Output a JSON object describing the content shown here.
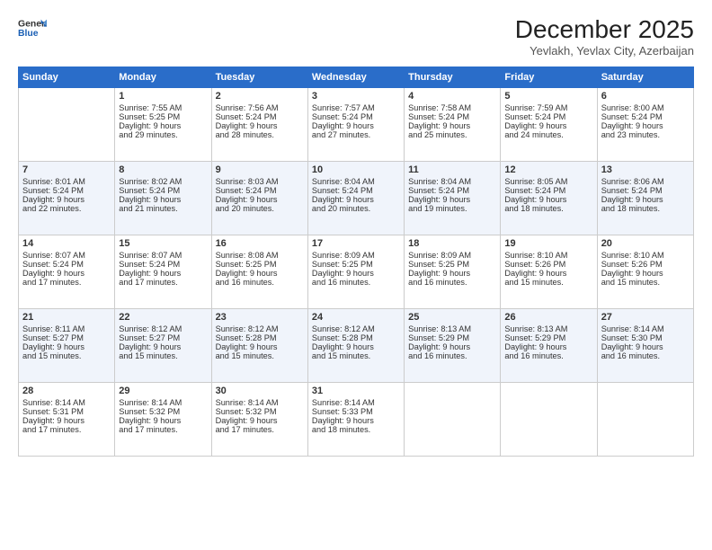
{
  "header": {
    "logo_line1": "General",
    "logo_line2": "Blue",
    "month": "December 2025",
    "location": "Yevlakh, Yevlax City, Azerbaijan"
  },
  "days_of_week": [
    "Sunday",
    "Monday",
    "Tuesday",
    "Wednesday",
    "Thursday",
    "Friday",
    "Saturday"
  ],
  "weeks": [
    [
      {
        "day": "",
        "info": ""
      },
      {
        "day": "1",
        "info": "Sunrise: 7:55 AM\nSunset: 5:25 PM\nDaylight: 9 hours\nand 29 minutes."
      },
      {
        "day": "2",
        "info": "Sunrise: 7:56 AM\nSunset: 5:24 PM\nDaylight: 9 hours\nand 28 minutes."
      },
      {
        "day": "3",
        "info": "Sunrise: 7:57 AM\nSunset: 5:24 PM\nDaylight: 9 hours\nand 27 minutes."
      },
      {
        "day": "4",
        "info": "Sunrise: 7:58 AM\nSunset: 5:24 PM\nDaylight: 9 hours\nand 25 minutes."
      },
      {
        "day": "5",
        "info": "Sunrise: 7:59 AM\nSunset: 5:24 PM\nDaylight: 9 hours\nand 24 minutes."
      },
      {
        "day": "6",
        "info": "Sunrise: 8:00 AM\nSunset: 5:24 PM\nDaylight: 9 hours\nand 23 minutes."
      }
    ],
    [
      {
        "day": "7",
        "info": "Sunrise: 8:01 AM\nSunset: 5:24 PM\nDaylight: 9 hours\nand 22 minutes."
      },
      {
        "day": "8",
        "info": "Sunrise: 8:02 AM\nSunset: 5:24 PM\nDaylight: 9 hours\nand 21 minutes."
      },
      {
        "day": "9",
        "info": "Sunrise: 8:03 AM\nSunset: 5:24 PM\nDaylight: 9 hours\nand 20 minutes."
      },
      {
        "day": "10",
        "info": "Sunrise: 8:04 AM\nSunset: 5:24 PM\nDaylight: 9 hours\nand 20 minutes."
      },
      {
        "day": "11",
        "info": "Sunrise: 8:04 AM\nSunset: 5:24 PM\nDaylight: 9 hours\nand 19 minutes."
      },
      {
        "day": "12",
        "info": "Sunrise: 8:05 AM\nSunset: 5:24 PM\nDaylight: 9 hours\nand 18 minutes."
      },
      {
        "day": "13",
        "info": "Sunrise: 8:06 AM\nSunset: 5:24 PM\nDaylight: 9 hours\nand 18 minutes."
      }
    ],
    [
      {
        "day": "14",
        "info": "Sunrise: 8:07 AM\nSunset: 5:24 PM\nDaylight: 9 hours\nand 17 minutes."
      },
      {
        "day": "15",
        "info": "Sunrise: 8:07 AM\nSunset: 5:24 PM\nDaylight: 9 hours\nand 17 minutes."
      },
      {
        "day": "16",
        "info": "Sunrise: 8:08 AM\nSunset: 5:25 PM\nDaylight: 9 hours\nand 16 minutes."
      },
      {
        "day": "17",
        "info": "Sunrise: 8:09 AM\nSunset: 5:25 PM\nDaylight: 9 hours\nand 16 minutes."
      },
      {
        "day": "18",
        "info": "Sunrise: 8:09 AM\nSunset: 5:25 PM\nDaylight: 9 hours\nand 16 minutes."
      },
      {
        "day": "19",
        "info": "Sunrise: 8:10 AM\nSunset: 5:26 PM\nDaylight: 9 hours\nand 15 minutes."
      },
      {
        "day": "20",
        "info": "Sunrise: 8:10 AM\nSunset: 5:26 PM\nDaylight: 9 hours\nand 15 minutes."
      }
    ],
    [
      {
        "day": "21",
        "info": "Sunrise: 8:11 AM\nSunset: 5:27 PM\nDaylight: 9 hours\nand 15 minutes."
      },
      {
        "day": "22",
        "info": "Sunrise: 8:12 AM\nSunset: 5:27 PM\nDaylight: 9 hours\nand 15 minutes."
      },
      {
        "day": "23",
        "info": "Sunrise: 8:12 AM\nSunset: 5:28 PM\nDaylight: 9 hours\nand 15 minutes."
      },
      {
        "day": "24",
        "info": "Sunrise: 8:12 AM\nSunset: 5:28 PM\nDaylight: 9 hours\nand 15 minutes."
      },
      {
        "day": "25",
        "info": "Sunrise: 8:13 AM\nSunset: 5:29 PM\nDaylight: 9 hours\nand 16 minutes."
      },
      {
        "day": "26",
        "info": "Sunrise: 8:13 AM\nSunset: 5:29 PM\nDaylight: 9 hours\nand 16 minutes."
      },
      {
        "day": "27",
        "info": "Sunrise: 8:14 AM\nSunset: 5:30 PM\nDaylight: 9 hours\nand 16 minutes."
      }
    ],
    [
      {
        "day": "28",
        "info": "Sunrise: 8:14 AM\nSunset: 5:31 PM\nDaylight: 9 hours\nand 17 minutes."
      },
      {
        "day": "29",
        "info": "Sunrise: 8:14 AM\nSunset: 5:32 PM\nDaylight: 9 hours\nand 17 minutes."
      },
      {
        "day": "30",
        "info": "Sunrise: 8:14 AM\nSunset: 5:32 PM\nDaylight: 9 hours\nand 17 minutes."
      },
      {
        "day": "31",
        "info": "Sunrise: 8:14 AM\nSunset: 5:33 PM\nDaylight: 9 hours\nand 18 minutes."
      },
      {
        "day": "",
        "info": ""
      },
      {
        "day": "",
        "info": ""
      },
      {
        "day": "",
        "info": ""
      }
    ]
  ]
}
